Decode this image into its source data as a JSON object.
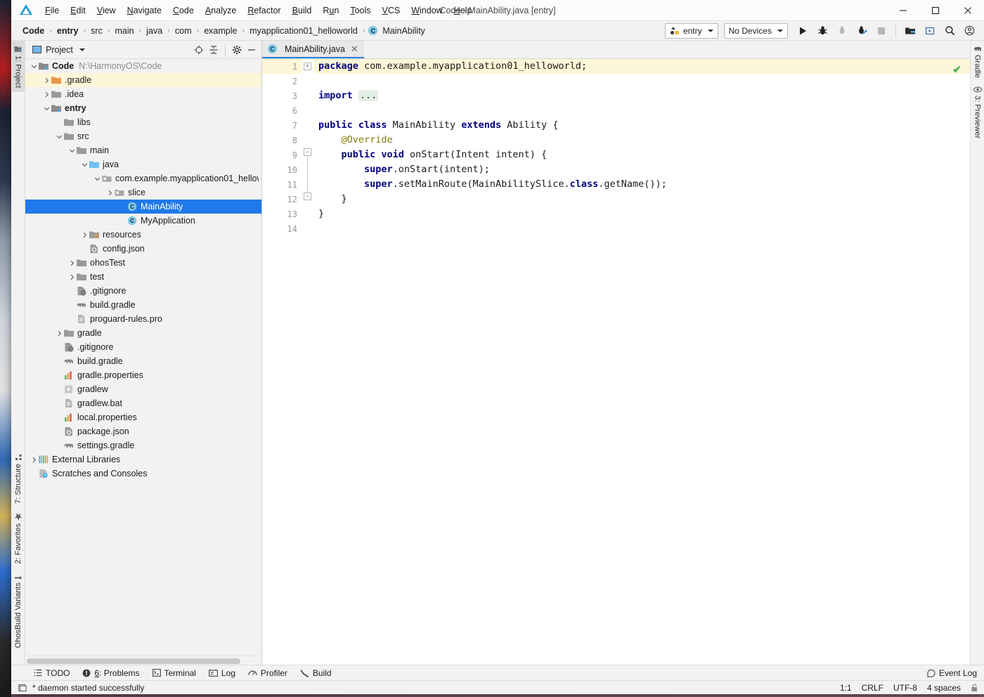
{
  "window": {
    "title": "Code - MainAbility.java [entry]",
    "logo_icon": "harmonyos-ide-logo",
    "minimize_label": "—",
    "maximize_label": "☐",
    "close_label": "✕"
  },
  "menubar": [
    {
      "label": "File",
      "mnemonic": "F"
    },
    {
      "label": "Edit",
      "mnemonic": "E"
    },
    {
      "label": "View",
      "mnemonic": "V"
    },
    {
      "label": "Navigate",
      "mnemonic": "N"
    },
    {
      "label": "Code",
      "mnemonic": "C"
    },
    {
      "label": "Analyze",
      "mnemonic": "A"
    },
    {
      "label": "Refactor",
      "mnemonic": "R"
    },
    {
      "label": "Build",
      "mnemonic": "B"
    },
    {
      "label": "Run",
      "mnemonic": "u"
    },
    {
      "label": "Tools",
      "mnemonic": "T"
    },
    {
      "label": "VCS",
      "mnemonic": "V"
    },
    {
      "label": "Window",
      "mnemonic": "W"
    },
    {
      "label": "Help",
      "mnemonic": "H"
    }
  ],
  "breadcrumb": {
    "items": [
      "Code",
      "entry",
      "src",
      "main",
      "java",
      "com",
      "example",
      "myapplication01_helloworld"
    ],
    "leaf": "MainAbility",
    "leaf_icon": "java-class-icon",
    "separator": "›"
  },
  "toolbar": {
    "run_config": "entry",
    "run_config_icon": "module-icon",
    "device_selector": "No Devices",
    "actions": [
      {
        "name": "run-button",
        "icon": "play-icon"
      },
      {
        "name": "debug-button",
        "icon": "bug-icon"
      },
      {
        "name": "attach-debugger-button",
        "icon": "attach-icon"
      },
      {
        "name": "profile-button",
        "icon": "profile-bug-icon"
      },
      {
        "name": "stop-button",
        "icon": "stop-square-icon"
      },
      {
        "name": "device-manager-button",
        "icon": "device-manager-icon"
      },
      {
        "name": "previewer-button",
        "icon": "previewer-icon"
      },
      {
        "name": "search-everywhere-button",
        "icon": "search-icon"
      },
      {
        "name": "account-button",
        "icon": "user-account-icon"
      }
    ]
  },
  "left_strip": {
    "top": [
      {
        "label": "1: Project",
        "icon": "project-folder-icon",
        "active": true
      }
    ],
    "bottom": [
      {
        "label": "7: Structure",
        "icon": "structure-icon"
      },
      {
        "label": "2: Favorites",
        "icon": "star-icon"
      },
      {
        "label": "OhosBuild Variants",
        "icon": "build-variants-icon"
      }
    ]
  },
  "right_strip": [
    {
      "label": "Gradle",
      "icon": "gradle-elephant-icon"
    },
    {
      "label": "3: Previewer",
      "icon": "eye-icon"
    }
  ],
  "project_panel": {
    "title": "Project",
    "title_icon": "project-view-icon",
    "actions": [
      {
        "name": "select-opened-file-button",
        "icon": "target-locate-icon"
      },
      {
        "name": "collapse-all-button",
        "icon": "collapse-all-icon"
      },
      {
        "name": "settings-button",
        "icon": "gear-icon"
      },
      {
        "name": "hide-panel-button",
        "icon": "minimize-icon"
      }
    ],
    "tree": [
      {
        "label": "Code",
        "path": "N:\\HarmonyOS\\Code",
        "icon": "project-root-icon",
        "indent": 0,
        "arrow": "down",
        "bold": true
      },
      {
        "label": ".gradle",
        "icon": "folder-orange-icon",
        "indent": 1,
        "arrow": "right",
        "highlight": true
      },
      {
        "label": ".idea",
        "icon": "folder-icon",
        "indent": 1,
        "arrow": "right"
      },
      {
        "label": "entry",
        "icon": "module-folder-icon",
        "indent": 1,
        "arrow": "down",
        "bold": true
      },
      {
        "label": "libs",
        "icon": "folder-icon",
        "indent": 2,
        "arrow": "none"
      },
      {
        "label": "src",
        "icon": "folder-icon",
        "indent": 2,
        "arrow": "down"
      },
      {
        "label": "main",
        "icon": "folder-icon",
        "indent": 3,
        "arrow": "down"
      },
      {
        "label": "java",
        "icon": "folder-source-icon",
        "indent": 4,
        "arrow": "down"
      },
      {
        "label": "com.example.myapplication01_hellow",
        "icon": "package-icon",
        "indent": 5,
        "arrow": "down"
      },
      {
        "label": "slice",
        "icon": "package-icon",
        "indent": 6,
        "arrow": "right"
      },
      {
        "label": "MainAbility",
        "icon": "java-class-icon",
        "indent": 7,
        "arrow": "none",
        "selected": true
      },
      {
        "label": "MyApplication",
        "icon": "java-class-icon",
        "indent": 7,
        "arrow": "none"
      },
      {
        "label": "resources",
        "icon": "resources-folder-icon",
        "indent": 4,
        "arrow": "right"
      },
      {
        "label": "config.json",
        "icon": "json-config-icon",
        "indent": 4,
        "arrow": "none"
      },
      {
        "label": "ohosTest",
        "icon": "folder-icon",
        "indent": 3,
        "arrow": "right"
      },
      {
        "label": "test",
        "icon": "folder-icon",
        "indent": 3,
        "arrow": "right"
      },
      {
        "label": ".gitignore",
        "icon": "gitignore-icon",
        "indent": 3,
        "arrow": "none"
      },
      {
        "label": "build.gradle",
        "icon": "gradle-file-icon",
        "indent": 3,
        "arrow": "none"
      },
      {
        "label": "proguard-rules.pro",
        "icon": "text-file-icon",
        "indent": 3,
        "arrow": "none"
      },
      {
        "label": "gradle",
        "icon": "folder-icon",
        "indent": 2,
        "arrow": "right"
      },
      {
        "label": ".gitignore",
        "icon": "gitignore-icon",
        "indent": 2,
        "arrow": "none"
      },
      {
        "label": "build.gradle",
        "icon": "gradle-file-icon",
        "indent": 2,
        "arrow": "none"
      },
      {
        "label": "gradle.properties",
        "icon": "properties-file-icon",
        "indent": 2,
        "arrow": "none"
      },
      {
        "label": "gradlew",
        "icon": "script-file-icon",
        "indent": 2,
        "arrow": "none"
      },
      {
        "label": "gradlew.bat",
        "icon": "text-file-icon",
        "indent": 2,
        "arrow": "none"
      },
      {
        "label": "local.properties",
        "icon": "properties-file-icon",
        "indent": 2,
        "arrow": "none"
      },
      {
        "label": "package.json",
        "icon": "json-config-icon",
        "indent": 2,
        "arrow": "none"
      },
      {
        "label": "settings.gradle",
        "icon": "gradle-file-icon",
        "indent": 2,
        "arrow": "none"
      },
      {
        "label": "External Libraries",
        "icon": "external-libraries-icon",
        "indent": 0,
        "arrow": "right"
      },
      {
        "label": "Scratches and Consoles",
        "icon": "scratches-icon",
        "indent": 0,
        "arrow": "none"
      }
    ]
  },
  "editor": {
    "tab": {
      "label": "MainAbility.java",
      "icon": "java-class-icon",
      "close_label": "✕"
    },
    "inspection_status": "✔",
    "gutter_line_numbers": [
      "1",
      "2",
      "3",
      "6",
      "7",
      "8",
      "9",
      "10",
      "11",
      "12",
      "13",
      "14"
    ],
    "override_marker_line": "9",
    "lines": [
      {
        "num": "1",
        "highlight": true,
        "tokens": [
          {
            "t": "package",
            "c": "kw"
          },
          {
            "t": " com.example.myapplication01_helloworld;",
            "c": ""
          }
        ]
      },
      {
        "num": "2",
        "tokens": []
      },
      {
        "num": "3",
        "tokens": [
          {
            "t": "import",
            "c": "kw"
          },
          {
            "t": " ",
            "c": ""
          },
          {
            "t": "...",
            "c": "fold"
          }
        ]
      },
      {
        "num": "6",
        "tokens": []
      },
      {
        "num": "7",
        "tokens": [
          {
            "t": "public class",
            "c": "kw"
          },
          {
            "t": " MainAbility ",
            "c": ""
          },
          {
            "t": "extends",
            "c": "kw"
          },
          {
            "t": " Ability {",
            "c": ""
          }
        ]
      },
      {
        "num": "8",
        "tokens": [
          {
            "t": "    @Override",
            "c": "ann"
          }
        ]
      },
      {
        "num": "9",
        "tokens": [
          {
            "t": "    ",
            "c": ""
          },
          {
            "t": "public void",
            "c": "kw"
          },
          {
            "t": " onStart(Intent intent) {",
            "c": ""
          }
        ]
      },
      {
        "num": "10",
        "tokens": [
          {
            "t": "        ",
            "c": ""
          },
          {
            "t": "super",
            "c": "kw"
          },
          {
            "t": ".onStart(intent);",
            "c": ""
          }
        ]
      },
      {
        "num": "11",
        "tokens": [
          {
            "t": "        ",
            "c": ""
          },
          {
            "t": "super",
            "c": "kw"
          },
          {
            "t": ".setMainRoute(MainAbilitySlice.",
            "c": ""
          },
          {
            "t": "class",
            "c": "kw"
          },
          {
            "t": ".getName());",
            "c": ""
          }
        ]
      },
      {
        "num": "12",
        "tokens": [
          {
            "t": "    }",
            "c": ""
          }
        ]
      },
      {
        "num": "13",
        "tokens": [
          {
            "t": "}",
            "c": ""
          }
        ]
      },
      {
        "num": "14",
        "tokens": []
      }
    ]
  },
  "bottom_tabs": [
    {
      "label": "TODO",
      "icon": "todo-list-icon",
      "mnemonic": ""
    },
    {
      "label": "6: Problems",
      "icon": "problems-icon",
      "mnemonic": "6"
    },
    {
      "label": "Terminal",
      "icon": "terminal-icon",
      "mnemonic": ""
    },
    {
      "label": "Log",
      "icon": "log-icon",
      "mnemonic": ""
    },
    {
      "label": "Profiler",
      "icon": "profiler-icon",
      "mnemonic": ""
    },
    {
      "label": "Build",
      "icon": "build-hammer-icon",
      "mnemonic": ""
    }
  ],
  "event_log": {
    "label": "Event Log",
    "icon": "event-log-icon"
  },
  "statusbar": {
    "message": "* daemon started successfully",
    "message_icon": "console-icon",
    "caret_position": "1:1",
    "line_separator": "CRLF",
    "encoding": "UTF-8",
    "indent": "4 spaces",
    "lock_icon": "unlocked-padlock-icon"
  },
  "colors": {
    "accent_blue": "#1f79e8",
    "keyword": "#000080",
    "annotation": "#808000",
    "highlight_row": "#fdf6d8",
    "ok_green": "#4caf50",
    "panel_bg": "#f2f2f2"
  }
}
